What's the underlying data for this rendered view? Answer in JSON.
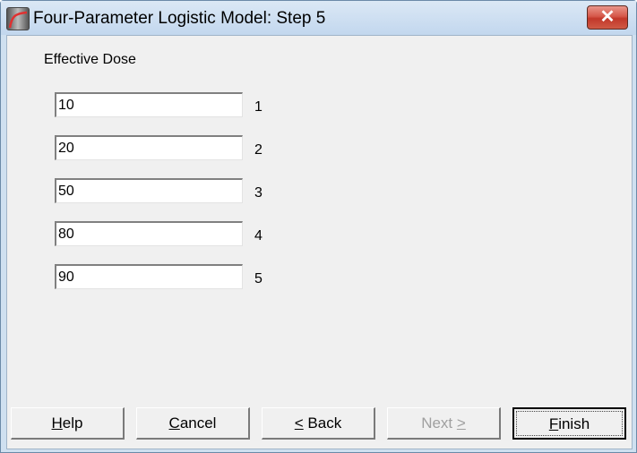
{
  "window": {
    "title": "Four-Parameter Logistic Model: Step 5",
    "app_icon": "logistic-curve-icon",
    "close_icon": "✕"
  },
  "form": {
    "section_label": "Effective Dose",
    "fields": [
      {
        "value": "10",
        "index": "1"
      },
      {
        "value": "20",
        "index": "2"
      },
      {
        "value": "50",
        "index": "3"
      },
      {
        "value": "80",
        "index": "4"
      },
      {
        "value": "90",
        "index": "5"
      }
    ]
  },
  "buttons": {
    "help": {
      "mnemonic": "H",
      "rest": "elp"
    },
    "cancel": {
      "mnemonic": "C",
      "rest": "ancel"
    },
    "back": {
      "mnemonic": "<",
      "rest": " Back"
    },
    "next": {
      "pre": "Next ",
      "mnemonic": ">",
      "enabled": false
    },
    "finish": {
      "mnemonic": "F",
      "rest": "inish",
      "default": true
    }
  }
}
